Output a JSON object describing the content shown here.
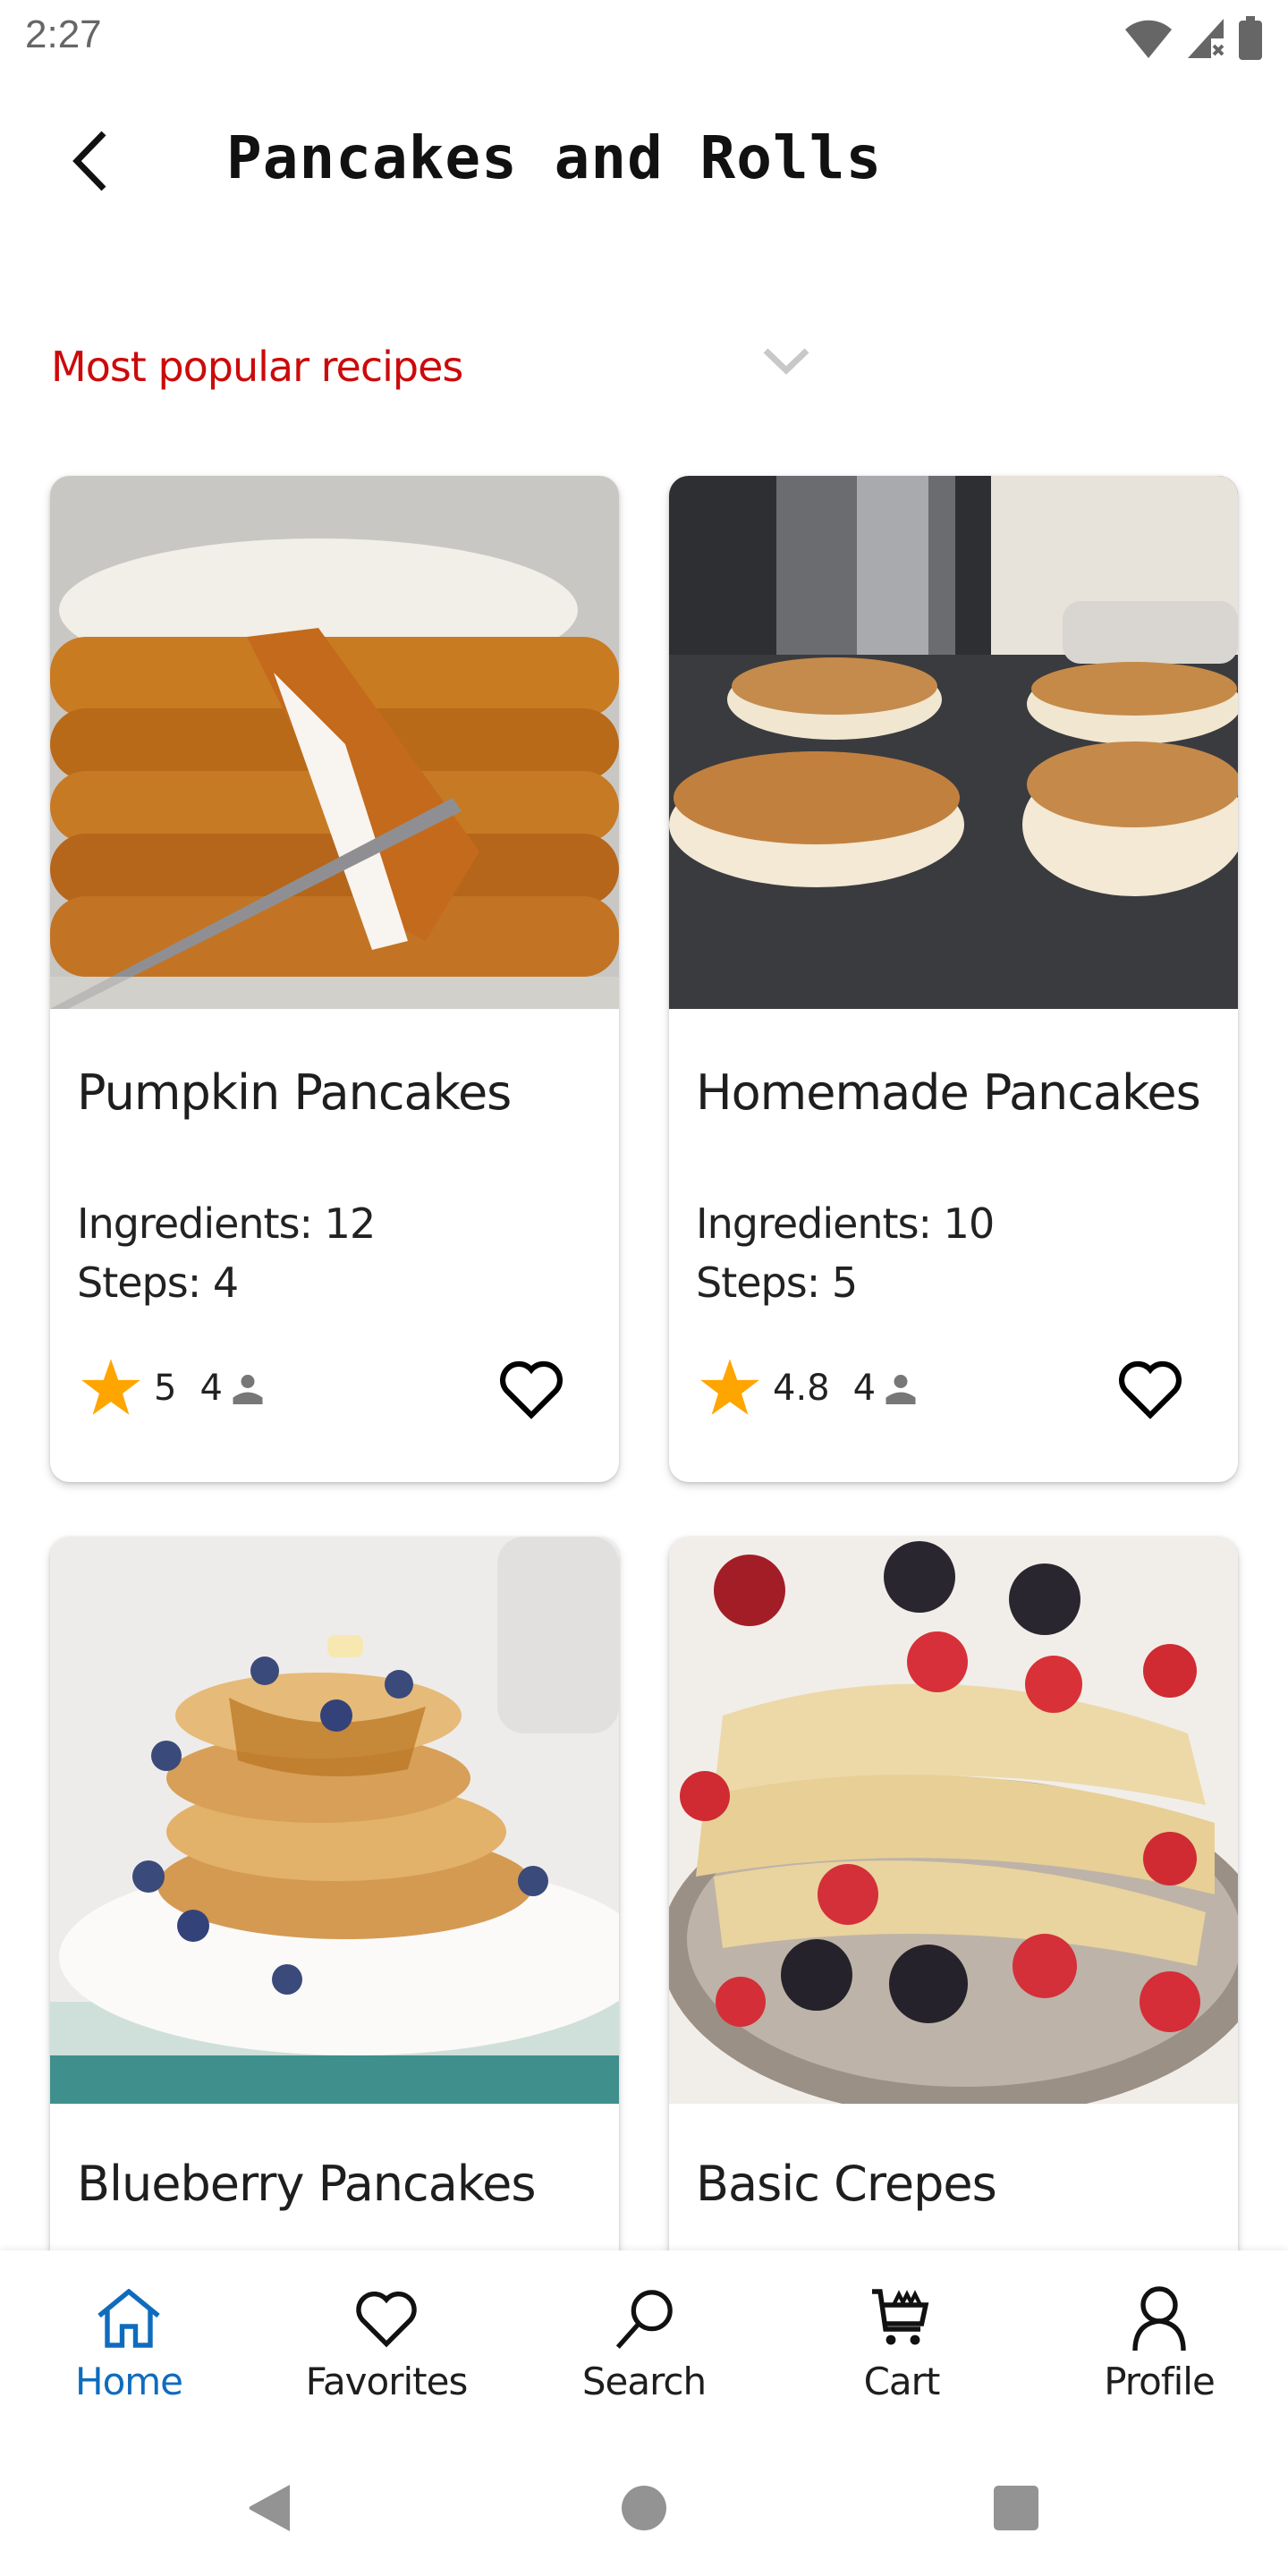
{
  "status_bar": {
    "time": "2:27",
    "icons": [
      "wifi-icon",
      "cell-signal-no-service-icon",
      "battery-icon"
    ]
  },
  "app_bar": {
    "back_icon": "chevron-left-icon",
    "title": "Pancakes and Rolls"
  },
  "sort": {
    "selected": "Most popular recipes",
    "icon": "chevron-down-icon",
    "colors": {
      "label": "#cc0a0a",
      "chevron": "#c8c8c8"
    }
  },
  "recipes": [
    {
      "title": "Pumpkin Pancakes",
      "ingredients_label": "Ingredients: 12",
      "steps_label": "Steps: 4",
      "rating": "5",
      "reviews": "4",
      "favorite": false,
      "image_desc": "Stack of pumpkin pancakes with whipped cream and a fork"
    },
    {
      "title": "Homemade Pancakes",
      "ingredients_label": "Ingredients: 10",
      "steps_label": "Steps: 5",
      "rating": "4.8",
      "reviews": "4",
      "favorite": false,
      "image_desc": "Fluffy pancakes cooking on a griddle"
    },
    {
      "title": "Blueberry Pancakes",
      "image_desc": "Stack of blueberry pancakes with syrup on a white plate"
    },
    {
      "title": "Basic Crepes",
      "image_desc": "Folded crepes with strawberries and blackberries"
    }
  ],
  "bottom_nav": {
    "items": [
      {
        "label": "Home",
        "icon": "home-icon",
        "active": true
      },
      {
        "label": "Favorites",
        "icon": "heart-icon",
        "active": false
      },
      {
        "label": "Search",
        "icon": "search-icon",
        "active": false
      },
      {
        "label": "Cart",
        "icon": "cart-icon",
        "active": false
      },
      {
        "label": "Profile",
        "icon": "person-icon",
        "active": false
      }
    ],
    "active_color": "#0f6cbd"
  },
  "system_nav": {
    "buttons": [
      "back-triangle-icon",
      "home-circle-icon",
      "recents-square-icon"
    ]
  },
  "colors": {
    "star": "#ffa500",
    "accent_red": "#cc0a0a",
    "accent_blue": "#0f6cbd",
    "status_gray": "#666666"
  }
}
